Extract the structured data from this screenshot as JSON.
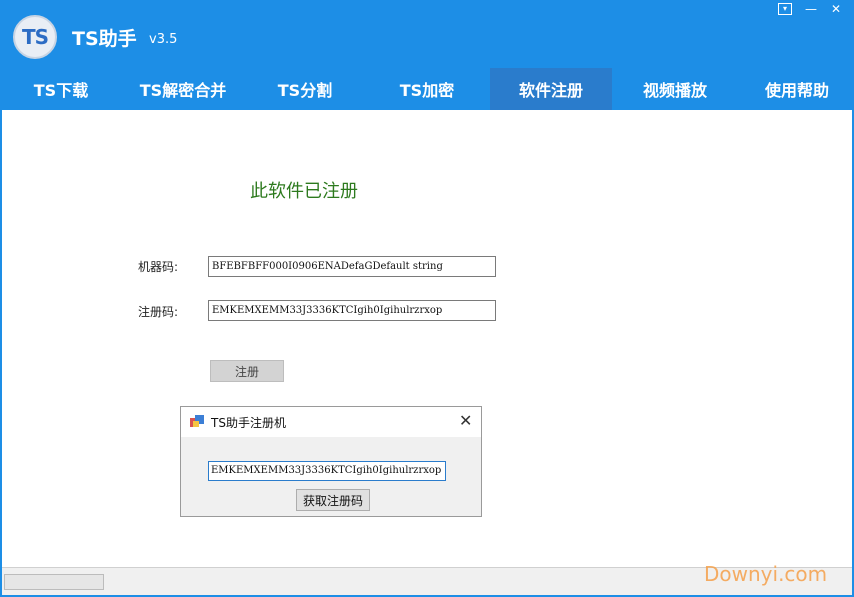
{
  "app": {
    "logo_text": "TS",
    "name": "TS助手",
    "version": "v3.5"
  },
  "window_controls": {
    "menu_icon": "dropdown-box-icon",
    "minimize_icon": "minimize-icon",
    "close_icon": "close-icon"
  },
  "nav": {
    "tabs": [
      {
        "label": "TS下载"
      },
      {
        "label": "TS解密合并"
      },
      {
        "label": "TS分割"
      },
      {
        "label": "TS加密"
      },
      {
        "label": "软件注册"
      },
      {
        "label": "视频播放"
      },
      {
        "label": "使用帮助"
      }
    ],
    "active_index": 4
  },
  "registration": {
    "status_text": "此软件已注册",
    "machine_code_label": "机器码:",
    "machine_code_value": "BFEBFBFF000I0906ENADefaGDefault string",
    "reg_code_label": "注册码:",
    "reg_code_value": "EMKEMXEMM33J3336KTCIgih0Igihulrzrxop",
    "register_button": "注册"
  },
  "dialog": {
    "title": "TS助手注册机",
    "code_value": "EMKEMXEMM33J3336KTCIgih0Igihulrzrxop",
    "button_label": "获取注册码"
  },
  "watermark": "Downyi.com",
  "colors": {
    "brand_blue": "#1d8ee6",
    "active_tab": "#2a7ccc",
    "status_green": "#2d7a1e"
  }
}
